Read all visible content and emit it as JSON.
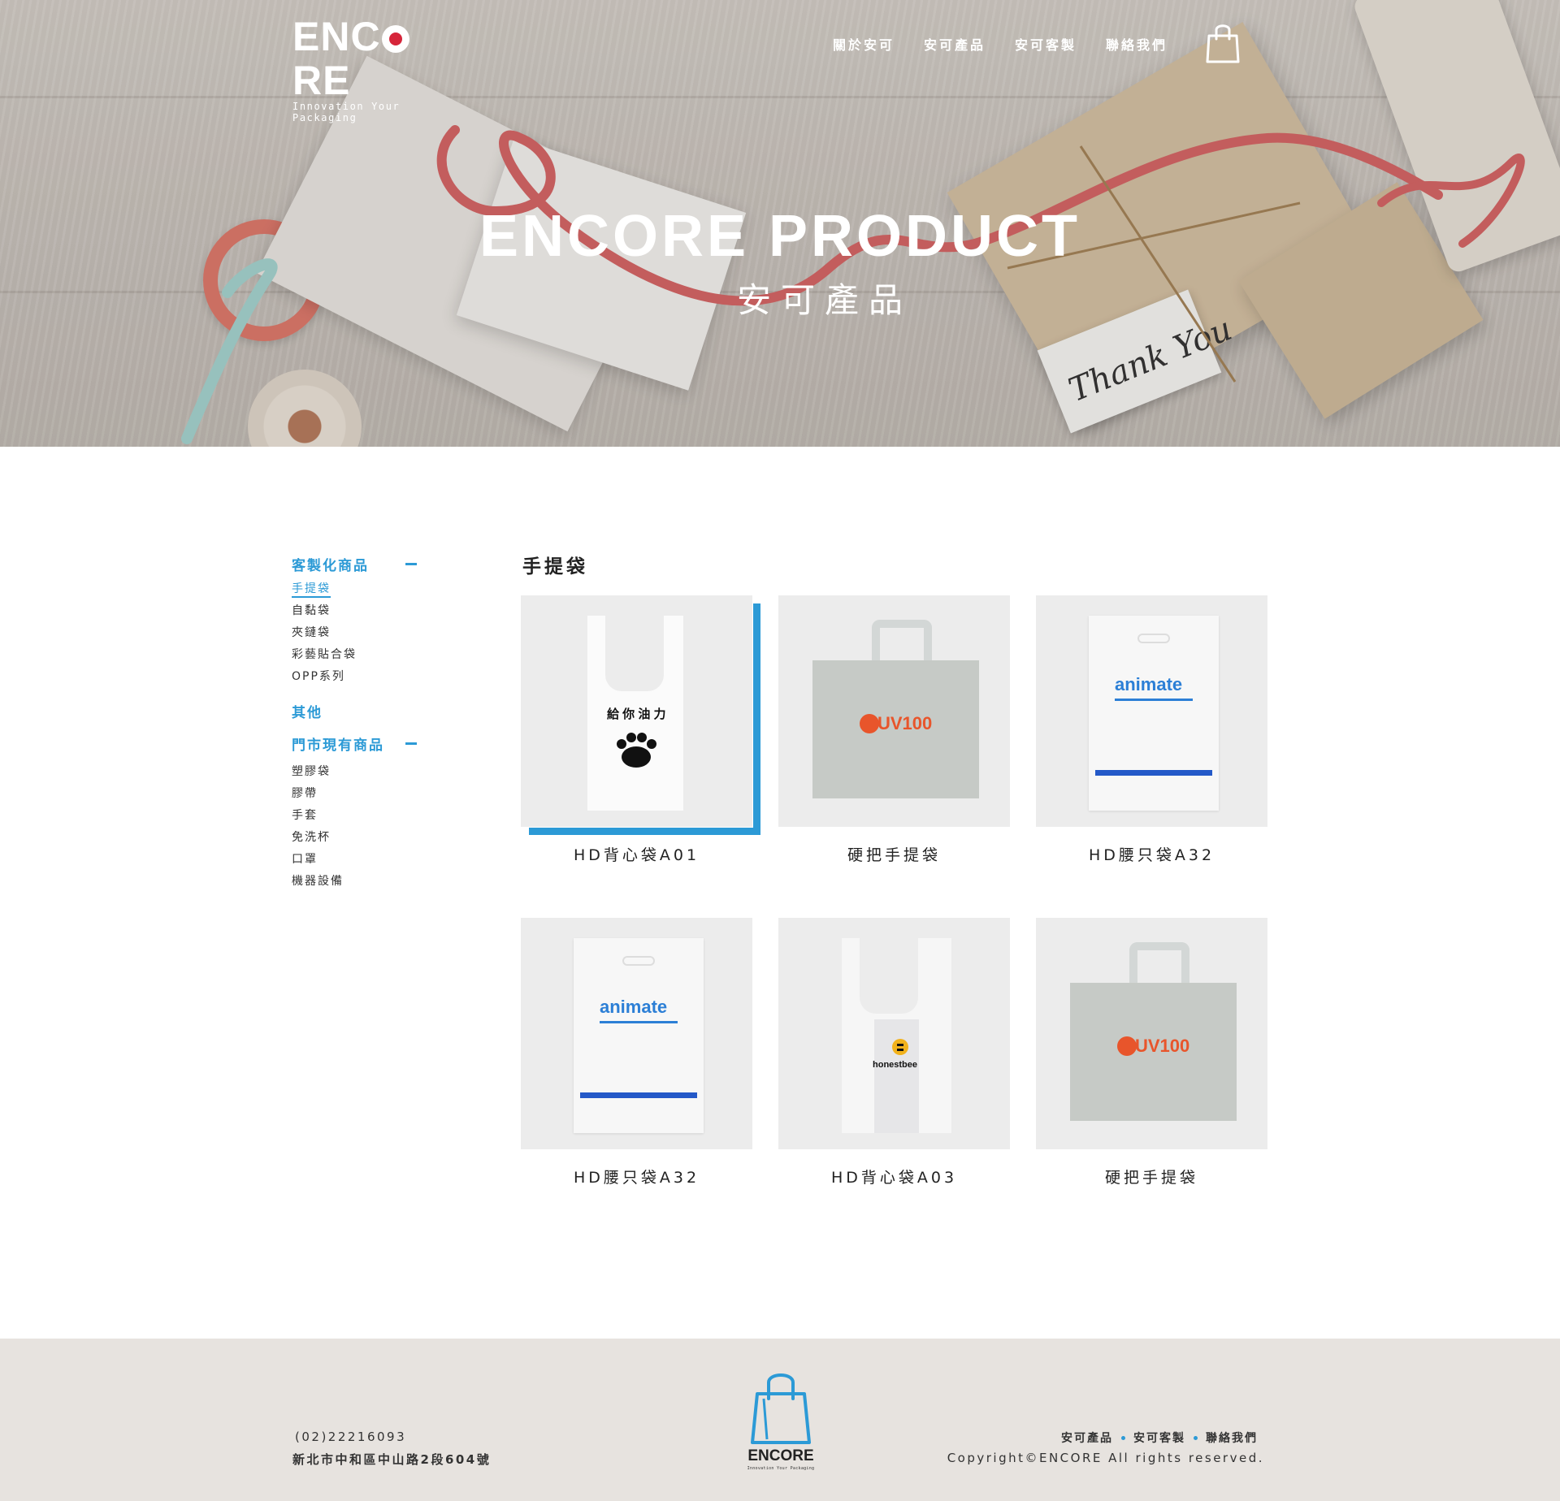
{
  "header": {
    "logo_word": "ENCORE",
    "logo_tagline": "Innovation Your Packaging",
    "nav": [
      "關於安可",
      "安可產品",
      "安可客製",
      "聯絡我們"
    ]
  },
  "hero": {
    "title": "ENCORE PRODUCT",
    "subtitle": "安可產品",
    "tag_text": "Thank You"
  },
  "sidebar": {
    "groups": [
      {
        "label": "客製化商品",
        "expanded": true,
        "items": [
          "手提袋",
          "自黏袋",
          "夾鏈袋",
          "彩藝貼合袋",
          "OPP系列"
        ],
        "active_index": 0
      },
      {
        "label": "其他",
        "expanded": false,
        "items": []
      },
      {
        "label": "門市現有商品",
        "expanded": true,
        "items": [
          "塑膠袋",
          "膠帶",
          "手套",
          "免洗杯",
          "口罩",
          "機器設備"
        ]
      }
    ]
  },
  "main": {
    "section_title": "手提袋",
    "products": [
      {
        "name": "HD背心袋A01",
        "image": "vest-bag-paw",
        "brand_text": "給 你 油 力"
      },
      {
        "name": "硬把手提袋",
        "image": "handle-bag-uv100",
        "brand_text": "UV100"
      },
      {
        "name": "HD腰只袋A32",
        "image": "die-cut-bag-animate",
        "brand_text": "animate"
      },
      {
        "name": "HD腰只袋A32",
        "image": "die-cut-bag-animate",
        "brand_text": "animate"
      },
      {
        "name": "HD背心袋A03",
        "image": "vest-bag-honestbee",
        "brand_text": "honestbee"
      },
      {
        "name": "硬把手提袋",
        "image": "handle-bag-uv100",
        "brand_text": "UV100"
      }
    ]
  },
  "footer": {
    "phone": "(02)22216093",
    "address": "新北市中和區中山路2段604號",
    "links": [
      "安可產品",
      "安可客製",
      "聯絡我們"
    ],
    "copyright": "Copyright©ENCORE All rights reserved.",
    "logo_word": "ENCORE",
    "logo_tagline": "Innovation Your Packaging"
  },
  "colors": {
    "accent": "#2c9ad6",
    "logo_red": "#d6253a",
    "footer_bg": "#e7e3df",
    "thumb_bg": "#ececec"
  }
}
